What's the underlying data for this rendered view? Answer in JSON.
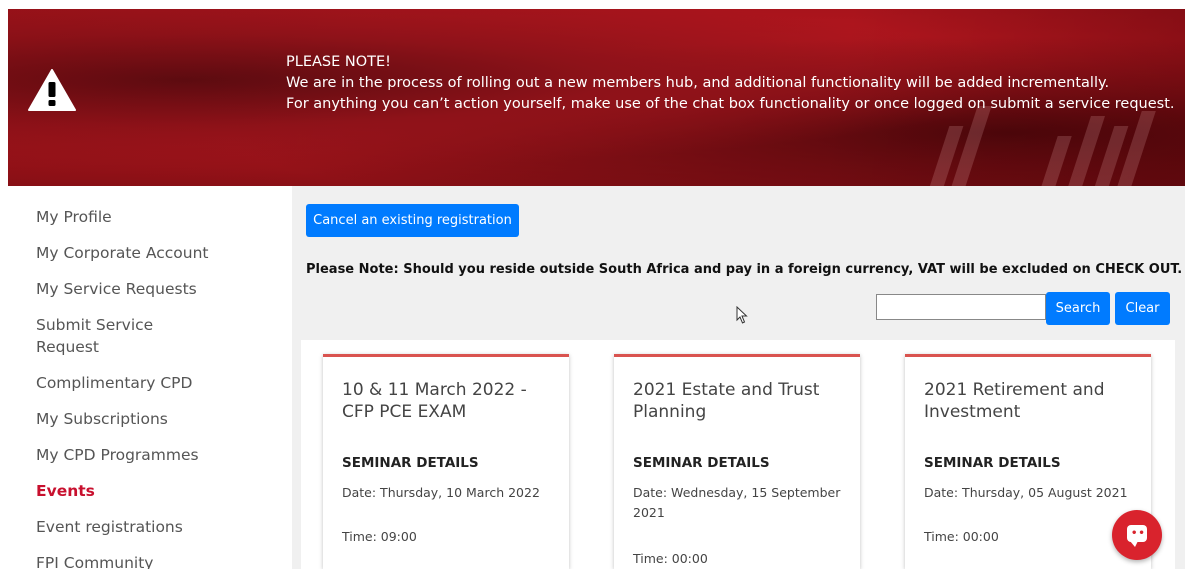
{
  "banner": {
    "heading": "PLEASE NOTE!",
    "line1": "We are in the process of rolling out a new members hub, and additional functionality will be added incrementally.",
    "line2": "For anything you can’t action yourself, make use of the chat box functionality or once logged on submit a service request.",
    "icon": "warning-triangle-icon"
  },
  "sidebar": {
    "items": [
      {
        "label": "My Profile"
      },
      {
        "label": "My Corporate Account"
      },
      {
        "label": "My Service Requests"
      },
      {
        "label": "Submit Service Request"
      },
      {
        "label": "Complimentary CPD"
      },
      {
        "label": "My Subscriptions"
      },
      {
        "label": "My CPD Programmes"
      },
      {
        "label": "Events",
        "active": true
      },
      {
        "label": "Event registrations"
      },
      {
        "label": "FPI Community"
      }
    ]
  },
  "main": {
    "cancel_label": "Cancel an existing registration",
    "note": "Please Note: Should you reside outside South Africa and pay in a foreign currency, VAT will be excluded on CHECK OUT.",
    "search": {
      "value": "",
      "placeholder": "",
      "search_label": "Search",
      "clear_label": "Clear"
    },
    "cards": [
      {
        "title": "10 & 11 March 2022 - CFP PCE EXAM",
        "section": "SEMINAR DETAILS",
        "date": "Date: Thursday, 10 March 2022",
        "time": "Time: 09:00"
      },
      {
        "title": "2021 Estate and Trust Planning",
        "section": "SEMINAR DETAILS",
        "date": "Date: Wednesday, 15 September 2021",
        "time": "Time: 00:00"
      },
      {
        "title": "2021 Retirement and Investment",
        "section": "SEMINAR DETAILS",
        "date": "Date: Thursday, 05 August 2021",
        "time": "Time: 00:00"
      }
    ]
  },
  "colors": {
    "accent": "#c8102e",
    "primary_button": "#007bff",
    "chat": "#d9232d"
  },
  "chat": {
    "icon": "chat-bubble-icon"
  }
}
